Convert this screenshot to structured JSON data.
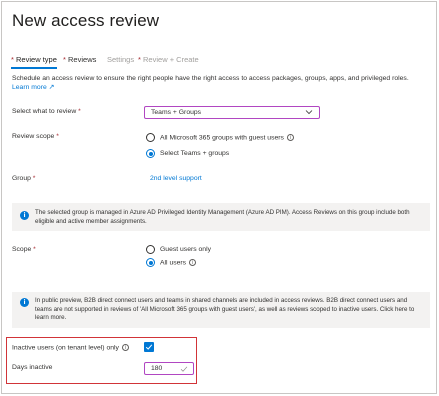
{
  "page": {
    "title": "New access review",
    "more": "···"
  },
  "tabs": [
    {
      "req": "* ",
      "label": "Review type"
    },
    {
      "req": "* ",
      "label": "Reviews"
    },
    {
      "req": "",
      "label": "Settings"
    },
    {
      "req": "* ",
      "label": "Review + Create"
    }
  ],
  "description": {
    "text": "Schedule an access review to ensure the right people have the right access to access packages, groups, apps, and privileged roles.",
    "link": "Learn more ↗"
  },
  "what_to_review": {
    "label": "Select what to review",
    "req": " *",
    "value": "Teams + Groups"
  },
  "review_scope": {
    "label": "Review scope",
    "req": " *",
    "options": [
      "All Microsoft 365 groups with guest users",
      "Select Teams + groups"
    ],
    "selected": 1
  },
  "group": {
    "label": "Group",
    "req": " *",
    "value": "2nd level support"
  },
  "pim_notice": "The selected group is managed in Azure AD Privileged Identity Management (Azure AD PIM). Access Reviews on this group include both eligible and active member assignments.",
  "scope": {
    "label": "Scope",
    "req": " *",
    "options": [
      "Guest users only",
      "All users"
    ],
    "selected": 1
  },
  "b2b_notice": "In public preview, B2B direct connect users and teams in shared channels are included in access reviews. B2B direct connect users and teams are not supported in reviews of 'All Microsoft 365 groups with guest users', as well as reviews scoped to inactive users. Click here to learn more.",
  "inactive": {
    "label": "Inactive users (on tenant level) only",
    "checked": true
  },
  "days_inactive": {
    "label": "Days inactive",
    "value": "180"
  },
  "colors": {
    "accent": "#0078d4",
    "required": "#a4262c",
    "highlight": "#d13438",
    "focus_border": "#b146c2"
  }
}
